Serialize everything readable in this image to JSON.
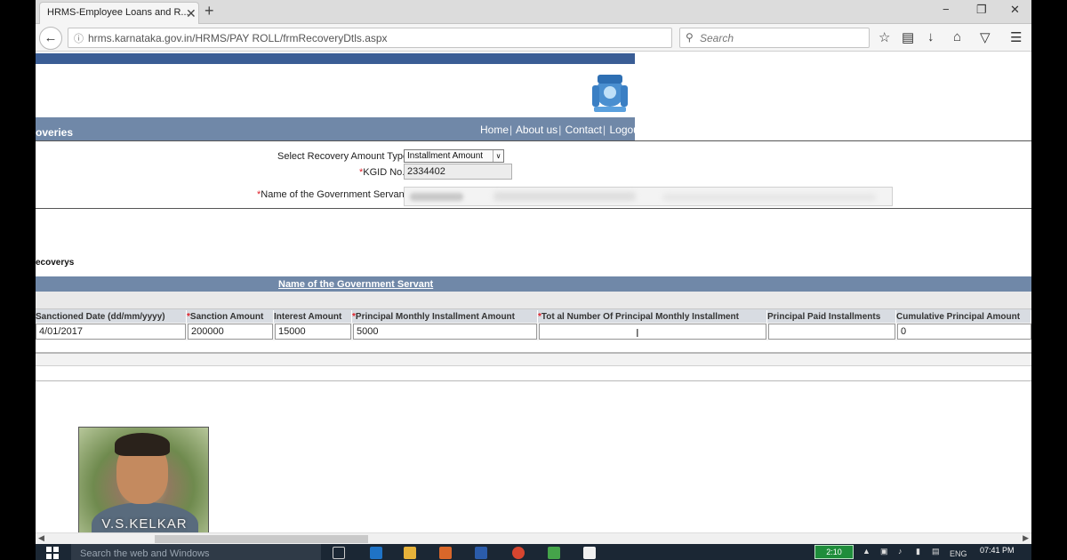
{
  "browser": {
    "tab_title": "HRMS-Employee Loans and R...",
    "tab_close": "✕",
    "new_tab": "+",
    "window_controls": [
      "−",
      "❐",
      "✕"
    ],
    "url": "hrms.karnataka.gov.in/HRMS/PAY ROLL/frmRecoveryDtls.aspx",
    "search_placeholder": "Search",
    "toolbar_icons": [
      "star-icon",
      "reader-icon",
      "download-icon",
      "home-icon",
      "pocket-icon",
      "menu-icon"
    ]
  },
  "page": {
    "nav_title": "overies",
    "nav_links": [
      "Home",
      "About us",
      "Contact",
      "Logout"
    ],
    "form": {
      "recovery_type_label": "Select Recovery Amount Type",
      "recovery_type_value": "Installment Amount",
      "kgid_label": "KGID No.",
      "kgid_value": "2334402",
      "name_label": "Name of the Government Servant",
      "required_marker": "*"
    },
    "section_title": "ecoverys",
    "grid_header_link": "Name of the Government Servant",
    "table": {
      "columns": [
        {
          "label": "Sanctioned Date (dd/mm/yyyy)",
          "required": false
        },
        {
          "label": "Sanction Amount",
          "required": true
        },
        {
          "label": "Interest Amount",
          "required": false
        },
        {
          "label": "Principal Monthly Installment Amount",
          "required": true
        },
        {
          "label": "Tot al Number Of Principal Monthly Installment",
          "required": true
        },
        {
          "label": "Principal Paid Installments",
          "required": false
        },
        {
          "label": "Cumulative Principal Amount",
          "required": false
        }
      ],
      "row": [
        "4/01/2017",
        "200000",
        "15000",
        "5000",
        "",
        "",
        "0"
      ]
    }
  },
  "overlay": {
    "webcam_name": "V.S.KELKAR"
  },
  "taskbar": {
    "search_placeholder": "Search the web and Windows",
    "badge": "2:10",
    "lang": "ENG",
    "time": "07:41 PM"
  },
  "colors": {
    "header_blue": "#3a5d95",
    "nav_slate": "#7088a8",
    "required_red": "#e0202a"
  }
}
